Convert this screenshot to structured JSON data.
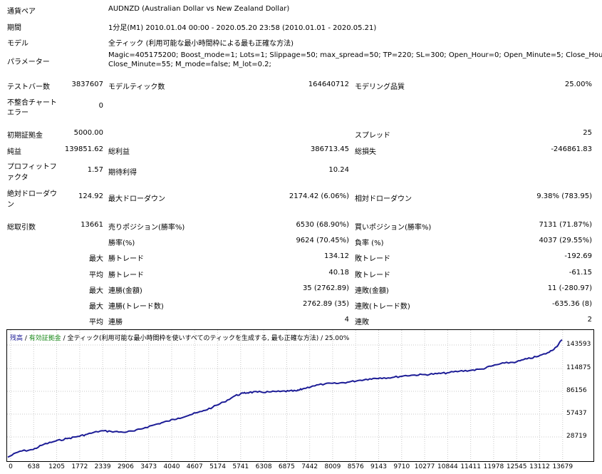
{
  "settings": {
    "symbol_label": "通貨ペア",
    "symbol_value": "AUDNZD (Australian Dollar vs New Zealand Dollar)",
    "period_label": "期間",
    "period_value": "1分足(M1) 2010.01.04 00:00 - 2020.05.20 23:58 (2010.01.01 - 2020.05.21)",
    "model_label": "モデル",
    "model_value": "全ティック (利用可能な最小時間枠による最も正確な方法)",
    "params_label": "パラメーター",
    "params_line1": "Magic=405175200; Boost_mode=1; Lots=1; Slippage=50; max_spread=50; TP=220; SL=300; Open_Hour=0; Open_Minute=5; Close_Hour=23;",
    "params_line2": "Close_Minute=55; M_mode=false; M_lot=0.2;"
  },
  "stats": {
    "bars_label": "テストバー数",
    "bars_value": "3837607",
    "ticks_label": "モデルティック数",
    "ticks_value": "164640712",
    "quality_label": "モデリング品質",
    "quality_value": "25.00%",
    "mismatch_label_1": "不整合チャート",
    "mismatch_label_2": "エラー",
    "mismatch_value": "0",
    "deposit_label": "初期証拠金",
    "deposit_value": "5000.00",
    "spread_label": "スプレッド",
    "spread_value": "25",
    "net_label": "純益",
    "net_value": "139851.62",
    "gross_profit_label": "総利益",
    "gross_profit_value": "386713.45",
    "gross_loss_label": "総損失",
    "gross_loss_value": "-246861.83",
    "pf_label_1": "プロフィットフ",
    "pf_label_2": "ァクタ",
    "pf_value": "1.57",
    "expected_label": "期待利得",
    "expected_value": "10.24",
    "abs_dd_label_1": "絶対ドローダウ",
    "abs_dd_label_2": "ン",
    "abs_dd_value": "124.92",
    "max_dd_label": "最大ドローダウン",
    "max_dd_value": "2174.42 (6.06%)",
    "rel_dd_label": "相対ドローダウン",
    "rel_dd_value": "9.38% (783.95)",
    "trades_label": "総取引数",
    "trades_value": "13661",
    "short_label": "売りポジション(勝率%)",
    "short_value": "6530 (68.90%)",
    "long_label": "買いポジション(勝率%)",
    "long_value": "7131 (71.87%)",
    "win_label": "勝率(%)",
    "win_value": "9624 (70.45%)",
    "loss_label": "負率 (%)",
    "loss_value": "4037 (29.55%)",
    "max_prefix": "最大",
    "avg_prefix": "平均",
    "largest_win_label": "勝トレード",
    "largest_win_value": "134.12",
    "largest_loss_label": "敗トレード",
    "largest_loss_value": "-192.69",
    "avg_win_label": "勝トレード",
    "avg_win_value": "40.18",
    "avg_loss_label": "敗トレード",
    "avg_loss_value": "-61.15",
    "cons_wins_amt_label": "連勝(金額)",
    "cons_wins_amt_value": "35 (2762.89)",
    "cons_losses_amt_label": "連敗(金額)",
    "cons_losses_amt_value": "11 (-280.97)",
    "cons_profit_label": "連勝(トレード数)",
    "cons_profit_value": "2762.89 (35)",
    "cons_loss_label": "連敗(トレード数)",
    "cons_loss_value": "-635.36 (8)",
    "avg_cons_wins_label": "連勝",
    "avg_cons_wins_value": "4",
    "avg_cons_losses_label": "連敗",
    "avg_cons_losses_value": "2"
  },
  "chart_data": {
    "type": "line",
    "legend_balance": "残高",
    "legend_sep1": " / ",
    "legend_equity": "有効証拠金",
    "legend_rest": " / 全ティック(利用可能な最小時間枠を使いすべてのティックを生成する, 最も正確な方法) / 25.00%",
    "colors": {
      "balance": "#1c1c96",
      "equity": "#1a8a1a",
      "grid": "#c8c8c8"
    },
    "xlim": [
      0,
      14000
    ],
    "ylim": [
      2000,
      150000
    ],
    "x_ticks": [
      "0",
      "638",
      "1205",
      "1772",
      "2339",
      "2906",
      "3473",
      "4040",
      "4607",
      "5174",
      "5741",
      "6308",
      "6875",
      "7442",
      "8009",
      "8576",
      "9143",
      "9710",
      "10277",
      "10844",
      "11411",
      "11978",
      "12545",
      "13112",
      "13679"
    ],
    "y_ticks": [
      "143593",
      "114875",
      "86156",
      "57437",
      "28719"
    ],
    "series": [
      {
        "x": [
          0,
          300,
          638,
          900,
          1205,
          1500,
          1772,
          2000,
          2339,
          2600,
          2906,
          3200,
          3473,
          3800,
          4040,
          4300,
          4607,
          4900,
          5174,
          5450,
          5741,
          5950,
          6100,
          6308,
          6600,
          6875,
          7100,
          7300,
          7442,
          7700,
          8009,
          8300,
          8576,
          8850,
          9143,
          9400,
          9710,
          10000,
          10277,
          10550,
          10844,
          11100,
          11411,
          11700,
          11978,
          12250,
          12545,
          12850,
          13112,
          13400,
          13679,
          13850,
          14000
        ],
        "y": [
          5000,
          12000,
          14000,
          20000,
          24000,
          27000,
          29500,
          32000,
          36000,
          35500,
          34500,
          36000,
          40000,
          44500,
          47500,
          51000,
          55000,
          59000,
          64000,
          70000,
          77500,
          80500,
          81500,
          81800,
          82000,
          82500,
          83000,
          83200,
          85500,
          89000,
          91500,
          92000,
          93500,
          95500,
          97500,
          98500,
          99000,
          101000,
          102000,
          102500,
          103500,
          104500,
          106500,
          107500,
          109000,
          113000,
          116000,
          117500,
          121000,
          124000,
          129000,
          135000,
          143593
        ]
      }
    ]
  }
}
